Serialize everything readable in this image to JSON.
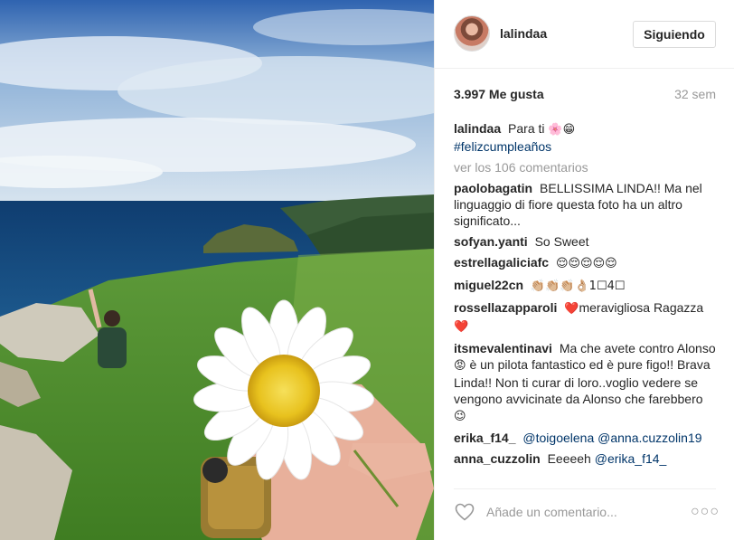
{
  "header": {
    "username": "lalindaa",
    "follow_label": "Siguiendo"
  },
  "stats": {
    "likes": "3.997 Me gusta",
    "time": "32 sem"
  },
  "caption": {
    "username": "lalindaa",
    "text": "Para ti",
    "emoji": "🌸😁",
    "hashtag": "#felizcumpleaños"
  },
  "load_more": "ver los 106 comentarios",
  "comments": [
    {
      "username": "paolobagatin",
      "text": "BELLISSIMA LINDA!! Ma nel linguaggio di fiore questa foto ha un altro significato..."
    },
    {
      "username": "sofyan.yanti",
      "text": "So Sweet"
    },
    {
      "username": "estrellagaliciafc",
      "text": "😌😌😌😌😌"
    },
    {
      "username": "miguel22cn",
      "text": "👏🏼👏🏼👏🏼👌🏼1☐4☐"
    },
    {
      "username": "rossellazapparoli",
      "text": "meravigliosa Ragazza",
      "emoji_before": "❤️",
      "emoji_after": "❤️"
    },
    {
      "username": "itsmevalentinavi",
      "text_a": "Ma che avete contro Alonso",
      "emoji_mid": "😡",
      "text_b": "è un pilota fantastico ed è pure figo!! Brava Linda!! Non ti curar di loro..voglio vedere se vengono avvicinate da Alonso che farebbero",
      "emoji_end": "😉"
    },
    {
      "username": "erika_f14_",
      "mention_1": "@toigoelena",
      "mention_2": "@anna.cuzzolin19"
    },
    {
      "username": "anna_cuzzolin",
      "text": "Eeeeeh",
      "mention": "@erika_f14_"
    }
  ],
  "footer": {
    "placeholder": "Añade un comentario...",
    "more": "○○○"
  },
  "icons": {
    "like": "heart-outline-icon",
    "more": "more-options-icon"
  },
  "colors": {
    "link": "#003569",
    "muted": "#999999",
    "border": "#efefef",
    "heart": "#e0245e"
  }
}
